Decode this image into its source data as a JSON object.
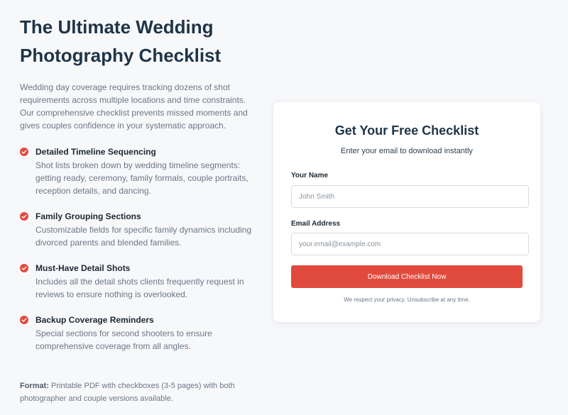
{
  "hero": {
    "title_line1": "The Ultimate Wedding",
    "title_line2": "Photography Checklist",
    "intro": "Wedding day coverage requires tracking dozens of shot requirements across multiple locations and time constraints. Our comprehensive checklist prevents missed moments and gives couples confidence in your systematic approach."
  },
  "features": [
    {
      "title": "Detailed Timeline Sequencing",
      "description": "Shot lists broken down by wedding timeline segments: getting ready, ceremony, family formals, couple portraits, reception details, and dancing.",
      "icon": "check-circle-icon"
    },
    {
      "title": "Family Grouping Sections",
      "description": "Customizable fields for specific family dynamics including divorced parents and blended families.",
      "icon": "check-circle-icon"
    },
    {
      "title": "Must-Have Detail Shots",
      "description": "Includes all the detail shots clients frequently request in reviews to ensure nothing is overlooked.",
      "icon": "check-circle-icon"
    },
    {
      "title": "Backup Coverage Reminders",
      "description": "Special sections for second shooters to ensure comprehensive coverage from all angles.",
      "icon": "check-circle-icon"
    }
  ],
  "format": {
    "label": "Format:",
    "text": " Printable PDF with checkboxes (3-5 pages) with both photographer and couple versions available."
  },
  "form": {
    "title": "Get Your Free Checklist",
    "subtitle": "Enter your email to download instantly",
    "name_label": "Your Name",
    "name_placeholder": "John Smith",
    "email_label": "Email Address",
    "email_placeholder": "your.email@example.com",
    "submit_label": "Download Checklist Now",
    "privacy": "We respect your privacy. Unsubscribe at any time."
  },
  "colors": {
    "accent": "#e14b3e",
    "heading": "#1f3447",
    "body_text": "#6b7785",
    "background": "#f7f8fa"
  }
}
